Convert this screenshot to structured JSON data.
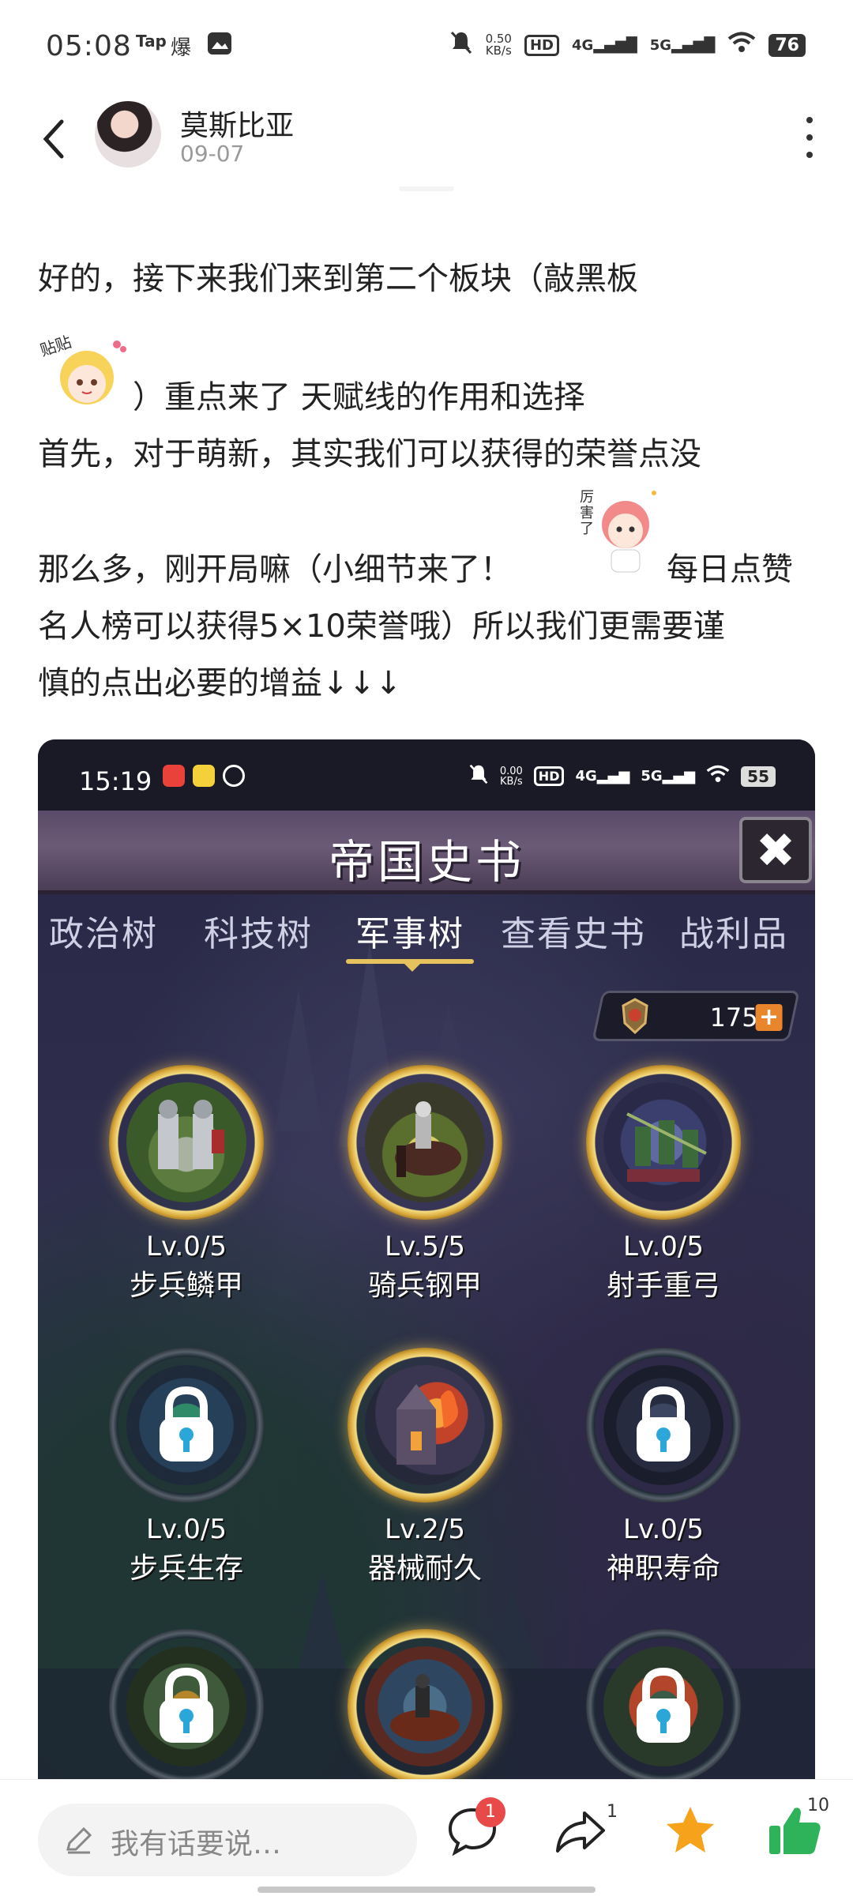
{
  "status_bar": {
    "time": "05:08",
    "app_icons": [
      "Tap",
      "爆"
    ],
    "net_speed": "0.50",
    "net_unit": "KB/s",
    "hd": "HD",
    "signal_1": "4G",
    "signal_2": "5G",
    "battery": "76"
  },
  "header": {
    "username": "莫斯比亚",
    "date": "09-07"
  },
  "post": {
    "line1": "好的，接下来我们来到第二个板块（敲黑板",
    "line2": "）重点来了 天赋线的作用和选择",
    "line3": "首先，对于萌新，其实我们可以获得的荣誉点没",
    "line4a": "那么多，刚开局嘛（小细节来了！",
    "line4b": "每日点赞",
    "line5": "名人榜可以获得5×10荣誉哦）所以我们更需要谨",
    "line6": "慎的点出必要的增益↓↓↓",
    "sticker1_text": "贴贴",
    "sticker2_text": "厉害了"
  },
  "game": {
    "status_time": "15:19",
    "status_speed": "0.00",
    "status_speed_unit": "KB/s",
    "status_hd": "HD",
    "status_sig1": "4G",
    "status_sig2": "5G",
    "status_battery": "55",
    "title": "帝国史书",
    "close_glyph": "✖",
    "tabs": [
      {
        "label": "政治树",
        "active": false
      },
      {
        "label": "科技树",
        "active": false
      },
      {
        "label": "军事树",
        "active": true
      },
      {
        "label": "查看史书",
        "active": false
      },
      {
        "label": "战利品",
        "active": false
      }
    ],
    "honor_points": "175",
    "honor_plus": "+",
    "nodes": [
      {
        "level": "Lv.0/5",
        "name": "步兵鳞甲",
        "unlocked": true
      },
      {
        "level": "Lv.5/5",
        "name": "骑兵钢甲",
        "unlocked": true
      },
      {
        "level": "Lv.0/5",
        "name": "射手重弓",
        "unlocked": true
      },
      {
        "level": "Lv.0/5",
        "name": "步兵生存",
        "unlocked": false
      },
      {
        "level": "Lv.2/5",
        "name": "器械耐久",
        "unlocked": true
      },
      {
        "level": "Lv.0/5",
        "name": "神职寿命",
        "unlocked": false
      },
      {
        "level": "",
        "name": "",
        "unlocked": false
      },
      {
        "level": "",
        "name": "",
        "unlocked": true
      },
      {
        "level": "",
        "name": "",
        "unlocked": false
      }
    ]
  },
  "bottom_bar": {
    "comment_placeholder": "我有话要说…",
    "comment_badge": "1",
    "share_count": "1",
    "like_count": "10"
  },
  "colors": {
    "accent_gold": "#e6c35c",
    "favorite_orange": "#f7a21b",
    "like_green": "#2fb35a",
    "badge_red": "#e84a4a"
  }
}
